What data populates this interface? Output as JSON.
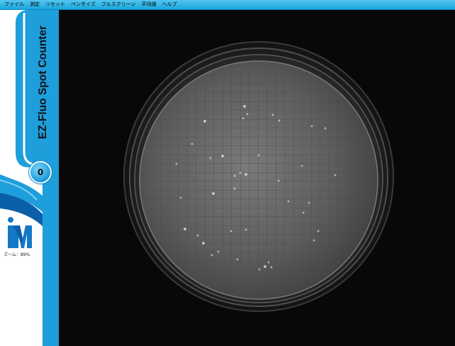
{
  "menu": [
    {
      "id": "file",
      "label": "ファイル"
    },
    {
      "id": "measure",
      "label": "測定"
    },
    {
      "id": "reset",
      "label": "リセット"
    },
    {
      "id": "pen-size",
      "label": "ペンサイズ"
    },
    {
      "id": "fullscreen",
      "label": "フルスクリーン"
    },
    {
      "id": "average",
      "label": "平均値"
    },
    {
      "id": "help",
      "label": "ヘルプ"
    }
  ],
  "sidebar": {
    "app_title": "EZ-Fluo Spot Counter",
    "count": "0",
    "logo_letter": "M",
    "zoom_label": "ズーム：89%"
  },
  "colors": {
    "menubar": "#2bb3e6",
    "sidebar_blue": "#1e9fdc",
    "sidebar_dark_blue": "#0b5fa8",
    "logo_blue": "#1478c8",
    "viewer_bg": "#080808"
  },
  "icons": {
    "logo": "merck-m-logo"
  }
}
